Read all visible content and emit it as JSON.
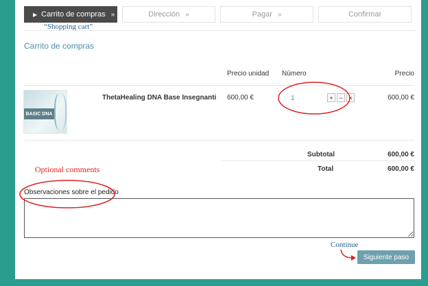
{
  "steps": {
    "cart": "Carrito de compras",
    "address": "Dirección",
    "pay": "Pagar",
    "confirm": "Confirmar",
    "separator": "»"
  },
  "annotations": {
    "shopping_cart": "“Shopping cart”",
    "optional_comments": "Optional comments",
    "continue": "Continue"
  },
  "cart": {
    "title": "Carrito de compras",
    "headers": {
      "unit_price": "Precio unidad",
      "number": "Número",
      "price": "Precio"
    },
    "item": {
      "image_label": "BASIC DNA",
      "name": "ThetaHealing DNA Base Insegnanti",
      "unit_price": "600,00 €",
      "quantity": "1",
      "plus": "+",
      "minus": "−",
      "remove": "×",
      "price": "600,00 €"
    },
    "subtotal_label": "Subtotal",
    "subtotal_value": "600,00 €",
    "total_label": "Total",
    "total_value": "600,00 €"
  },
  "observations": {
    "label": "Observaciones sobre el pedido",
    "value": ""
  },
  "next_button": "Siguiente paso",
  "colors": {
    "background": "#2a9d8f",
    "accent": "#4f8faf",
    "annotation_red": "#e02020",
    "annotation_blue": "#1f5f8f"
  }
}
